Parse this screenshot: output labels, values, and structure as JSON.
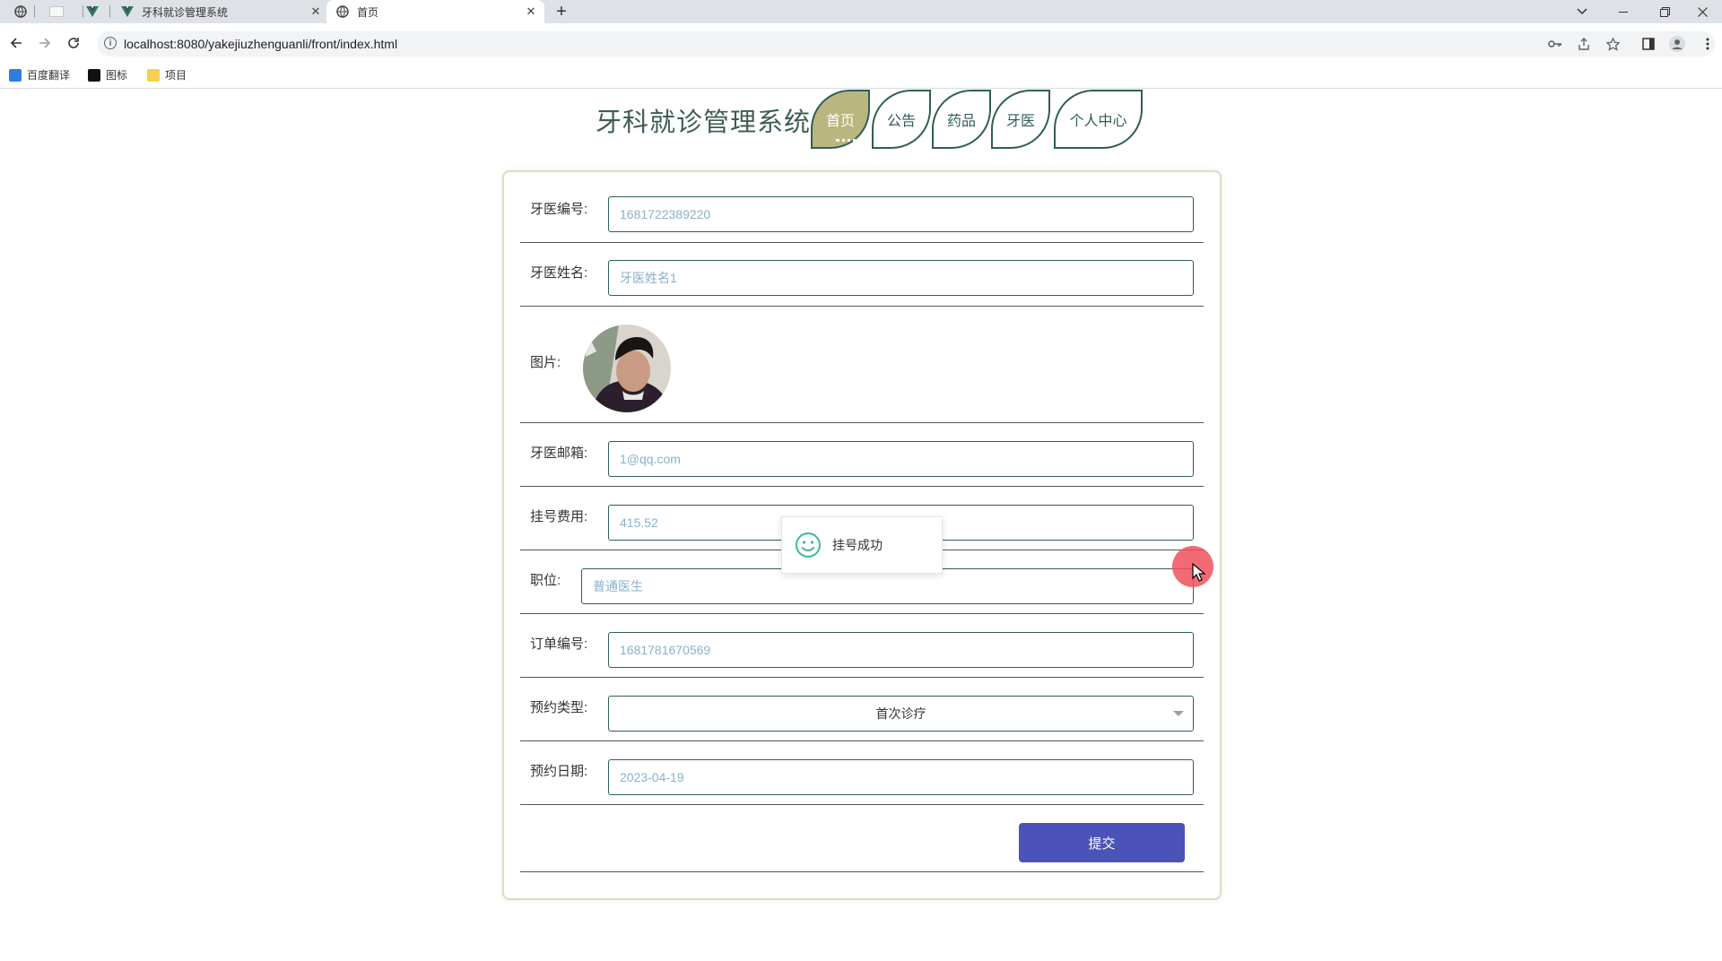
{
  "browser": {
    "tabs": [
      {
        "title": "牙科就诊管理系统",
        "close": "✕"
      },
      {
        "title": "首页",
        "close": "✕"
      }
    ],
    "new_tab": "+",
    "url": "localhost:8080/yakejiuzhenguanli/front/index.html",
    "bookmarks": [
      "百度翻译",
      "图标",
      "项目"
    ]
  },
  "site": {
    "title": "牙科就诊管理系统",
    "nav": [
      "首页",
      "公告",
      "药品",
      "牙医",
      "个人中心"
    ],
    "active_nav": "首页"
  },
  "form": {
    "fields": [
      {
        "label": "牙医编号:",
        "value": "1681722389220"
      },
      {
        "label": "牙医姓名:",
        "value": "牙医姓名1"
      },
      {
        "label": "图片:"
      },
      {
        "label": "牙医邮箱:",
        "value": "1@qq.com"
      },
      {
        "label": "挂号费用:",
        "value": "415.52"
      },
      {
        "label": "职位:",
        "value": "普通医生"
      },
      {
        "label": "订单编号:",
        "value": "1681781670569"
      },
      {
        "label": "预约类型:",
        "value": "首次诊疗"
      },
      {
        "label": "预约日期:",
        "value": "2023-04-19"
      }
    ],
    "submit_label": "提交"
  },
  "toast": {
    "message": "挂号成功"
  },
  "colors": {
    "theme_green": "#2f5e56",
    "active_tab": "#b9b67f",
    "submit": "#4c53b8",
    "input_text": "#8ab1c9",
    "toast_icon": "#3bb89a"
  }
}
